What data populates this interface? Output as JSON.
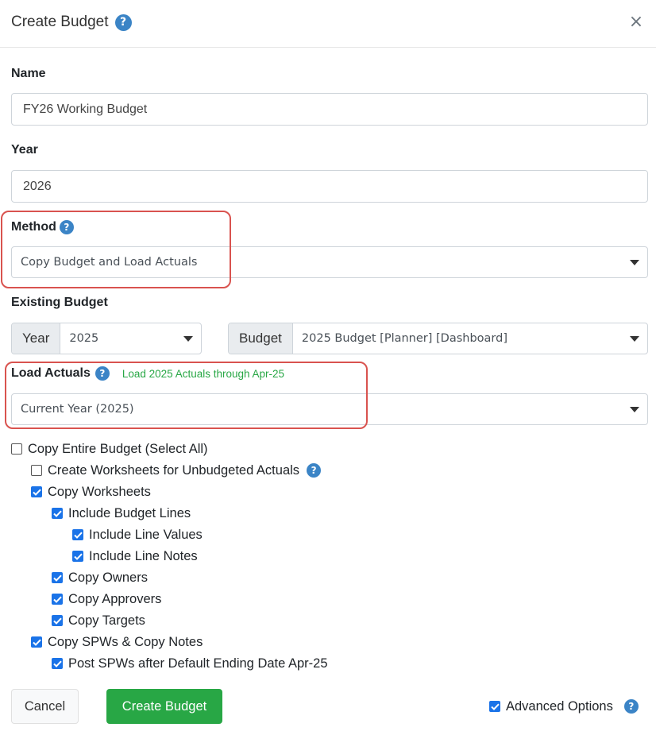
{
  "header": {
    "title": "Create Budget",
    "help_icon": "question-icon",
    "close_label": "×"
  },
  "form": {
    "name": {
      "label": "Name",
      "value": "FY26 Working Budget"
    },
    "year": {
      "label": "Year",
      "value": "2026"
    },
    "method": {
      "label": "Method",
      "selected": "Copy Budget and Load Actuals"
    },
    "existing_budget": {
      "label": "Existing Budget",
      "year_addon": "Year",
      "year_selected": "2025",
      "budget_addon": "Budget",
      "budget_selected": "2025 Budget [Planner] [Dashboard]"
    },
    "load_actuals": {
      "label": "Load Actuals",
      "note": "Load 2025 Actuals through Apr-25",
      "selected": "Current Year (2025)"
    }
  },
  "options": [
    {
      "label": "Copy Entire Budget (Select All)",
      "checked": false
    },
    {
      "label": "Create Worksheets for Unbudgeted Actuals",
      "checked": false,
      "help": true
    },
    {
      "label": "Copy Worksheets",
      "checked": true
    },
    {
      "label": "Include Budget Lines",
      "checked": true
    },
    {
      "label": "Include Line Values",
      "checked": true
    },
    {
      "label": "Include Line Notes",
      "checked": true
    },
    {
      "label": "Copy Owners",
      "checked": true
    },
    {
      "label": "Copy Approvers",
      "checked": true
    },
    {
      "label": "Copy Targets",
      "checked": true
    },
    {
      "label": "Copy SPWs & Copy Notes",
      "checked": true
    },
    {
      "label": "Post SPWs after Default Ending Date Apr-25",
      "checked": true
    }
  ],
  "footer": {
    "cancel_label": "Cancel",
    "create_label": "Create Budget",
    "advanced_label": "Advanced Options",
    "advanced_checked": true
  },
  "colors": {
    "accent_blue": "#3b84c6",
    "checkbox_blue": "#1a73e8",
    "success_green": "#28a745",
    "highlight_red": "#d9534f"
  }
}
